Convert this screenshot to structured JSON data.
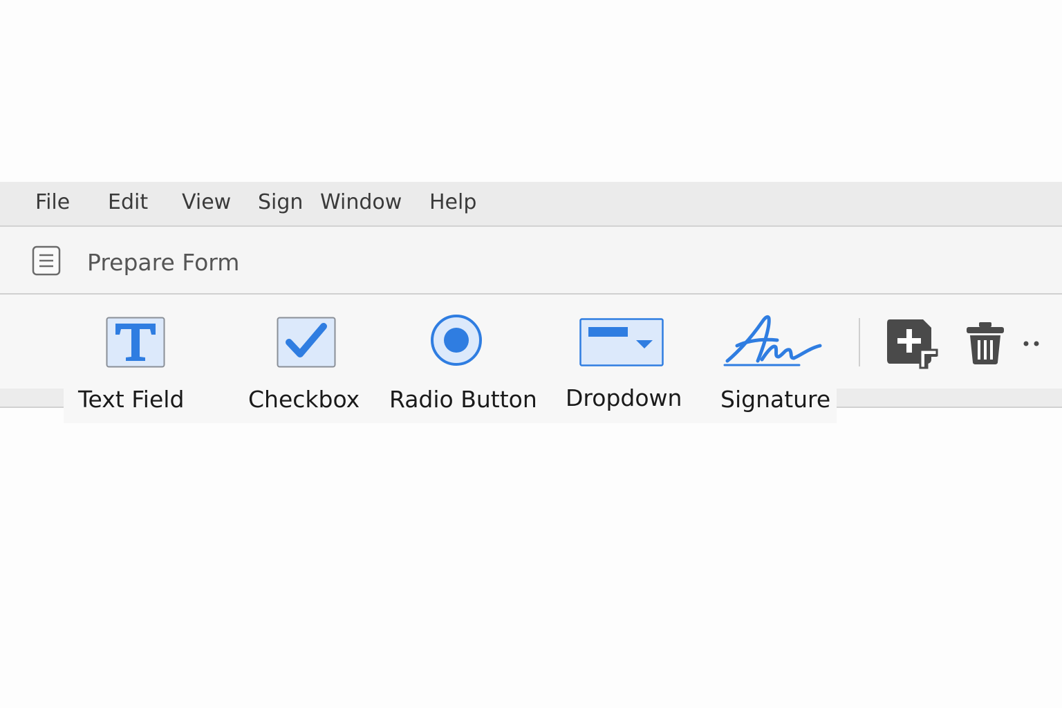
{
  "menubar": {
    "items": [
      {
        "label": "File"
      },
      {
        "label": "Edit"
      },
      {
        "label": "View"
      },
      {
        "label": "Sign"
      },
      {
        "label": "Window"
      },
      {
        "label": "Help"
      }
    ]
  },
  "form_header": {
    "icon": "form-document-icon",
    "title": "Prepare Form"
  },
  "tools": [
    {
      "label": "Text Field",
      "icon": "text-field-icon"
    },
    {
      "label": "Checkbox",
      "icon": "checkbox-icon"
    },
    {
      "label": "Radio Button",
      "icon": "radio-button-icon"
    },
    {
      "label": "Dropdown",
      "icon": "dropdown-icon"
    },
    {
      "label": "Signature",
      "icon": "signature-icon"
    }
  ],
  "actions": [
    {
      "icon": "add-field-icon"
    },
    {
      "icon": "trash-icon"
    },
    {
      "icon": "more-icon"
    }
  ],
  "colors": {
    "accent": "#2f7de1",
    "accent_light": "#dce9fb",
    "icon_dark": "#4a4a4a"
  }
}
